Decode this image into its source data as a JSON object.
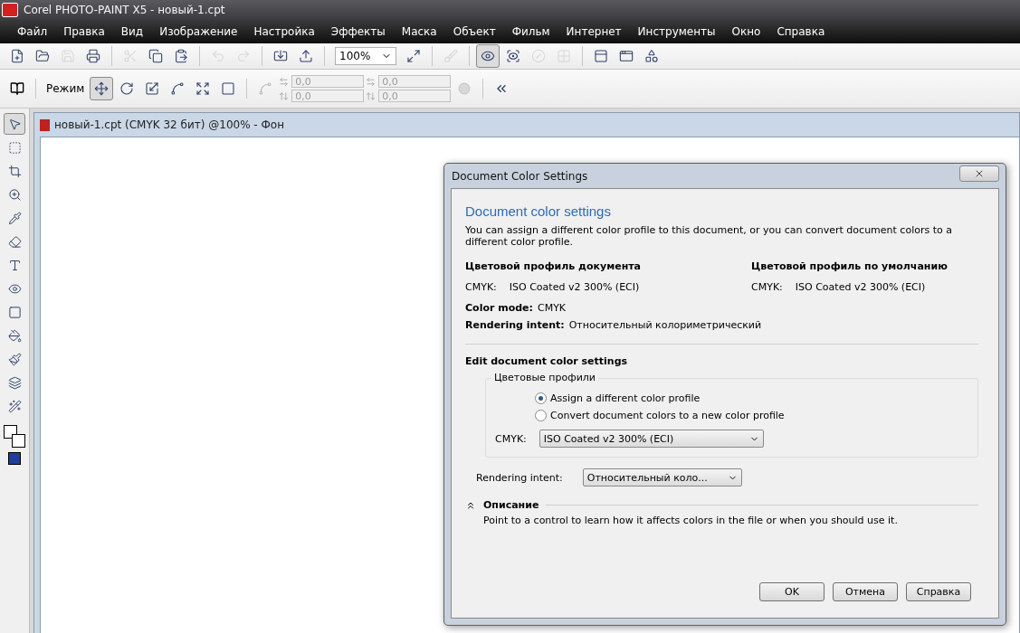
{
  "window": {
    "title": "Corel PHOTO-PAINT X5 - новый-1.cpt"
  },
  "menu": [
    "Файл",
    "Правка",
    "Вид",
    "Изображение",
    "Настройка",
    "Эффекты",
    "Маска",
    "Объект",
    "Фильм",
    "Интернет",
    "Инструменты",
    "Окно",
    "Справка"
  ],
  "toolbar": {
    "groups": [
      [
        {
          "kind": "new",
          "disabled": false
        },
        {
          "kind": "open",
          "disabled": false
        },
        {
          "kind": "save",
          "disabled": true
        },
        {
          "kind": "print",
          "disabled": false
        }
      ],
      [
        {
          "kind": "cut",
          "disabled": true
        },
        {
          "kind": "copy",
          "disabled": false
        },
        {
          "kind": "paste",
          "disabled": false
        }
      ],
      [
        {
          "kind": "undo",
          "disabled": true
        },
        {
          "kind": "redo",
          "disabled": true
        }
      ],
      [
        {
          "kind": "import",
          "disabled": false
        },
        {
          "kind": "export",
          "disabled": false
        }
      ]
    ],
    "zoom": "100%",
    "after": [
      [
        {
          "kind": "fit",
          "disabled": false
        }
      ],
      [
        {
          "kind": "brush",
          "disabled": true
        }
      ],
      [
        {
          "kind": "eye",
          "disabled": false,
          "selected": true
        },
        {
          "kind": "view",
          "disabled": false,
          "selected": false
        },
        {
          "kind": "stop",
          "disabled": true,
          "selected": false
        },
        {
          "kind": "grid",
          "disabled": true,
          "selected": false
        }
      ],
      [
        {
          "kind": "launch",
          "disabled": false,
          "selected": false
        },
        {
          "kind": "window",
          "disabled": false,
          "selected": false
        },
        {
          "kind": "shape",
          "disabled": false,
          "selected": false
        }
      ]
    ]
  },
  "property_bar": {
    "mode_label": "Режим",
    "transforms": [
      {
        "kind": "move",
        "selected": true
      },
      {
        "kind": "rotate",
        "selected": false
      },
      {
        "kind": "scale",
        "selected": false
      },
      {
        "kind": "skew",
        "selected": false
      },
      {
        "kind": "resize",
        "selected": false
      },
      {
        "kind": "perspective",
        "selected": false
      }
    ],
    "fields": [
      {
        "value": "0,0",
        "disabled": true
      },
      {
        "value": "0,0",
        "disabled": true
      },
      {
        "value": "0,0",
        "disabled": true
      },
      {
        "value": "0,0",
        "disabled": true
      }
    ]
  },
  "toolbox": [
    {
      "kind": "pointer",
      "selected": true
    },
    {
      "kind": "marquee",
      "selected": false
    },
    {
      "kind": "crop",
      "selected": false
    },
    {
      "kind": "zoom",
      "selected": false
    },
    {
      "kind": "eyedropper",
      "selected": false
    },
    {
      "kind": "eraser",
      "selected": false
    },
    {
      "kind": "text",
      "selected": false
    },
    {
      "kind": "redeye",
      "selected": false
    },
    {
      "kind": "rect",
      "selected": false
    },
    {
      "kind": "fill",
      "selected": false
    },
    {
      "kind": "paint",
      "selected": false
    },
    {
      "kind": "shadow",
      "selected": false
    },
    {
      "kind": "effect",
      "selected": false
    }
  ],
  "document": {
    "title": "новый-1.cpt (CMYK 32 бит) @100% - Фон"
  },
  "dialog": {
    "title": "Document Color Settings",
    "heading": "Document color settings",
    "intro": "You can assign a different color profile to this document, or you can convert document colors to a different color profile.",
    "doc_profile": {
      "heading": "Цветовой профиль документа",
      "label": "CMYK:",
      "value": "ISO Coated v2 300% (ECI)"
    },
    "default_profile": {
      "heading": "Цветовой профиль по умолчанию",
      "label": "CMYK:",
      "value": "ISO Coated v2 300% (ECI)"
    },
    "color_mode": {
      "label": "Color mode:",
      "value": "CMYK"
    },
    "rendering": {
      "label": "Rendering intent:",
      "value": "Относительный колориметрический"
    },
    "edit_heading": "Edit document color settings",
    "group_title": "Цветовые профили",
    "options": [
      {
        "label": "Assign a different color profile",
        "selected": true
      },
      {
        "label": "Convert document colors to a new color profile",
        "selected": false
      }
    ],
    "profile_select": {
      "label": "CMYK:",
      "value": "ISO Coated v2 300% (ECI)"
    },
    "intent_select": {
      "label": "Rendering intent:",
      "value": "Относительный коло..."
    },
    "description": {
      "heading": "Описание",
      "expanded": true,
      "text": "Point to a control to learn how it affects colors in the file or when you should use it."
    },
    "buttons": [
      "OK",
      "Отмена",
      "Справка"
    ]
  }
}
